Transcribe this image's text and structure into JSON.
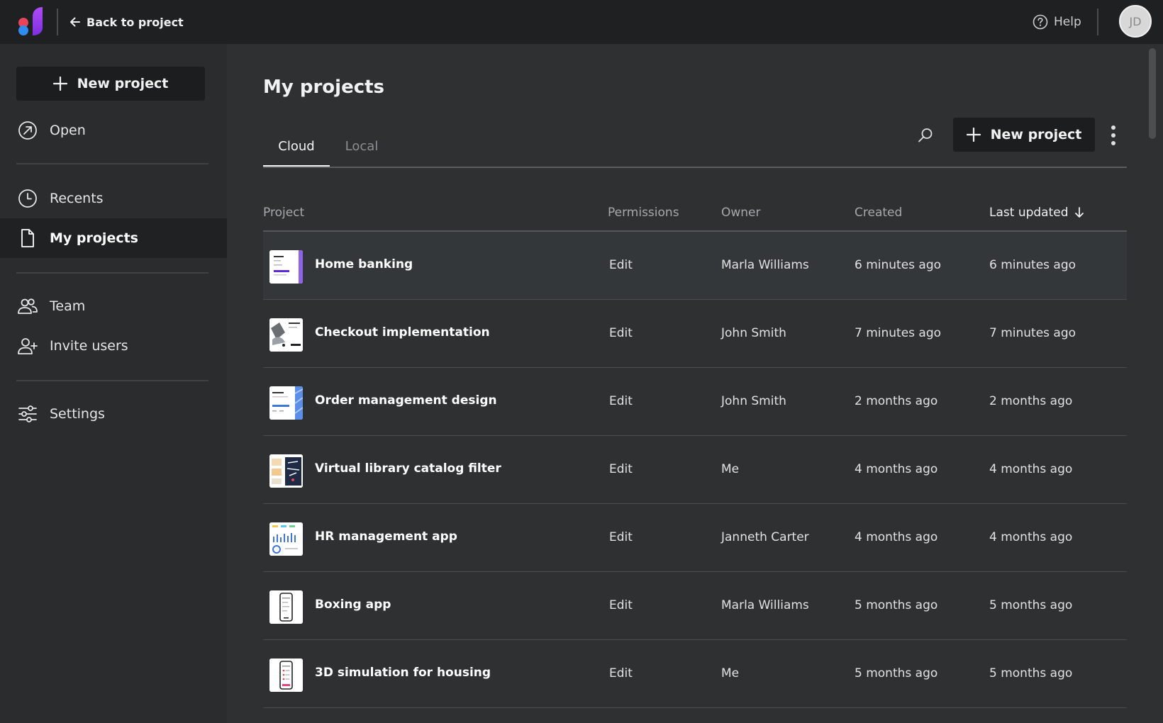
{
  "topbar": {
    "back_label": "Back to project",
    "help_label": "Help",
    "avatar_initials": "JD"
  },
  "sidebar": {
    "new_project_label": "New project",
    "items": [
      {
        "label": "Open",
        "icon": "open-arrow-icon"
      },
      {
        "label": "Recents",
        "icon": "clock-icon"
      },
      {
        "label": "My projects",
        "icon": "document-icon",
        "active": true
      },
      {
        "label": "Team",
        "icon": "team-icon"
      },
      {
        "label": "Invite users",
        "icon": "add-user-icon"
      },
      {
        "label": "Settings",
        "icon": "sliders-icon"
      }
    ]
  },
  "main": {
    "title": "My projects",
    "tabs": [
      {
        "label": "Cloud",
        "active": true
      },
      {
        "label": "Local",
        "active": false
      }
    ],
    "new_project_label": "New project"
  },
  "table": {
    "columns": [
      "Project",
      "Permissions",
      "Owner",
      "Created",
      "Last updated"
    ],
    "sorted_column": "Last updated",
    "rows": [
      {
        "name": "Home banking",
        "permissions": "Edit",
        "owner": "Marla Williams",
        "created": "6 minutes ago",
        "updated": "6 minutes ago"
      },
      {
        "name": "Checkout implementation",
        "permissions": "Edit",
        "owner": "John Smith",
        "created": "7 minutes ago",
        "updated": "7 minutes ago"
      },
      {
        "name": "Order management design",
        "permissions": "Edit",
        "owner": "John Smith",
        "created": "2 months ago",
        "updated": "2 months ago"
      },
      {
        "name": "Virtual library catalog filter",
        "permissions": "Edit",
        "owner": "Me",
        "created": "4 months ago",
        "updated": "4 months ago"
      },
      {
        "name": "HR management app",
        "permissions": "Edit",
        "owner": "Janneth Carter",
        "created": "4 months ago",
        "updated": "4 months ago"
      },
      {
        "name": "Boxing app",
        "permissions": "Edit",
        "owner": "Marla Williams",
        "created": "5 months ago",
        "updated": "5 months ago"
      },
      {
        "name": "3D simulation for housing",
        "permissions": "Edit",
        "owner": "Me",
        "created": "5 months ago",
        "updated": "5 months ago"
      }
    ]
  },
  "colors": {
    "topbar_bg": "#1f2021",
    "sidebar_bg": "#2a2c2e",
    "main_bg": "#2e3032",
    "button_bg": "#1c1d1e",
    "logo_red": "#e8455a",
    "logo_blue": "#2f8cf0",
    "logo_purple": "#9b3cf0"
  }
}
